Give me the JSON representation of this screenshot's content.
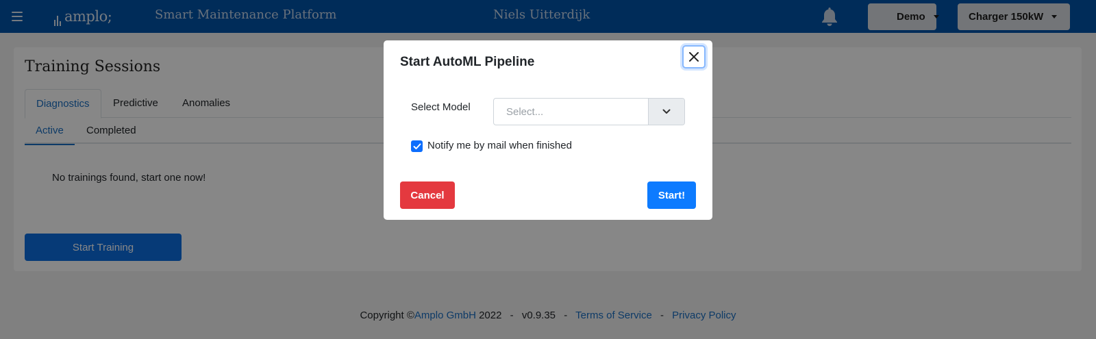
{
  "header": {
    "logo_text": "amplo;",
    "platform_title": "Smart Maintenance Platform",
    "user_name": "Niels Uitterdijk",
    "demo_label": "Demo",
    "charger_label": "Charger 150kW",
    "icons": [
      "menu-icon",
      "bell-icon",
      "caret-down-icon"
    ]
  },
  "main": {
    "title": "Training Sessions",
    "tabs": [
      {
        "label": "Diagnostics",
        "active": true
      },
      {
        "label": "Predictive",
        "active": false
      },
      {
        "label": "Anomalies",
        "active": false
      }
    ],
    "subtabs": [
      {
        "label": "Active",
        "active": true
      },
      {
        "label": "Completed",
        "active": false
      }
    ],
    "empty_message": "No trainings found, start one now!",
    "start_training_label": "Start Training"
  },
  "footer": {
    "copyright_prefix": "Copyright ©",
    "company": "Amplo GmbH",
    "year": "2022",
    "version": "v0.9.35",
    "terms": "Terms of Service",
    "privacy": "Privacy Policy",
    "separator": "-"
  },
  "modal": {
    "title": "Start AutoML Pipeline",
    "select_label": "Select Model",
    "select_placeholder": "Select...",
    "notify_label": "Notify me by mail when finished",
    "notify_checked": true,
    "cancel_label": "Cancel",
    "start_label": "Start!"
  },
  "colors": {
    "header_bg": "#0054a8",
    "primary": "#0d6efd",
    "danger": "#e4393f",
    "link": "#1a6fc2"
  }
}
